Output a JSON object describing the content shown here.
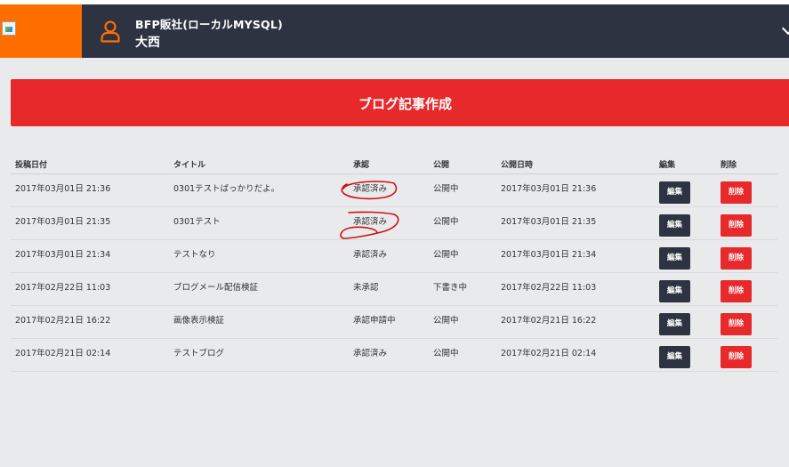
{
  "header": {
    "company": "BFP販社(ローカルMYSQL)",
    "user": "大西",
    "brand_color": "#ff6f00",
    "bar_color": "#2d3340",
    "logo_icon": "broken-image-icon",
    "user_icon": "user-icon",
    "menu_icon": "chevron-down-icon"
  },
  "actions": {
    "create_label": "ブログ記事作成",
    "accent_color": "#e8292b"
  },
  "table": {
    "columns": [
      "投稿日付",
      "タイトル",
      "承認",
      "公開",
      "公開日時",
      "編集",
      "削除"
    ],
    "rows": [
      {
        "posted": "2017年03月01日 21:36",
        "title": "0301テストばっかりだよ。",
        "approval": "承認済み",
        "status": "公開中",
        "published": "2017年03月01日 21:36",
        "edit": "編集",
        "delete": "削除"
      },
      {
        "posted": "2017年03月01日 21:35",
        "title": "0301テスト",
        "approval": "承認済み",
        "status": "公開中",
        "published": "2017年03月01日 21:35",
        "edit": "編集",
        "delete": "削除"
      },
      {
        "posted": "2017年03月01日 21:34",
        "title": "テストなり",
        "approval": "承認済み",
        "status": "公開中",
        "published": "2017年03月01日 21:34",
        "edit": "編集",
        "delete": "削除"
      },
      {
        "posted": "2017年02月22日 11:03",
        "title": "ブログメール配信検証",
        "approval": "未承認",
        "status": "下書き中",
        "published": "2017年02月22日 11:03",
        "edit": "編集",
        "delete": "削除"
      },
      {
        "posted": "2017年02月21日 16:22",
        "title": "画像表示検証",
        "approval": "承認申請中",
        "status": "公開中",
        "published": "2017年02月21日 16:22",
        "edit": "編集",
        "delete": "削除"
      },
      {
        "posted": "2017年02月21日 02:14",
        "title": "テストブログ",
        "approval": "承認済み",
        "status": "公開中",
        "published": "2017年02月21日 02:14",
        "edit": "編集",
        "delete": "削除"
      }
    ]
  },
  "annotation_color": "#d01010"
}
